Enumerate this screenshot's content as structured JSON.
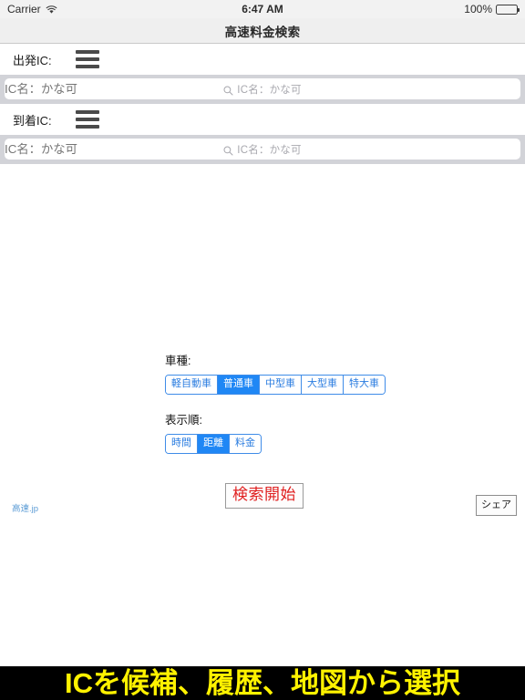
{
  "status_bar": {
    "carrier": "Carrier",
    "wifi_icon": "wifi-icon",
    "time": "6:47 AM",
    "battery_percent": "100%",
    "battery_icon": "battery-full-icon"
  },
  "nav": {
    "title": "高速料金検索"
  },
  "departure": {
    "label": "出発IC:",
    "menu_icon": "hamburger-menu-icon",
    "search_icon": "search-icon",
    "placeholder": "IC名：かな可",
    "value": ""
  },
  "arrival": {
    "label": "到着IC:",
    "menu_icon": "hamburger-menu-icon",
    "search_icon": "search-icon",
    "placeholder": "IC名：かな可",
    "value": ""
  },
  "vehicle": {
    "label": "車種:",
    "options": [
      {
        "label": "軽自動車",
        "selected": false
      },
      {
        "label": "普通車",
        "selected": true
      },
      {
        "label": "中型車",
        "selected": false
      },
      {
        "label": "大型車",
        "selected": false
      },
      {
        "label": "特大車",
        "selected": false
      }
    ]
  },
  "sort_order": {
    "label": "表示順:",
    "options": [
      {
        "label": "時間",
        "selected": false
      },
      {
        "label": "距離",
        "selected": true
      },
      {
        "label": "料金",
        "selected": false
      }
    ]
  },
  "actions": {
    "search_start": "検索開始",
    "share": "シェア",
    "site_link": "高速.jp"
  },
  "banner": {
    "text": "ICを候補、履歴、地図から選択"
  },
  "colors": {
    "accent_blue": "#1f87f5",
    "segment_border": "#3f8ce8",
    "search_red": "#e02020",
    "banner_bg": "#000000",
    "banner_text": "#fff200",
    "band_gray": "#d2d3d8",
    "chrome_gray": "#efefef"
  }
}
